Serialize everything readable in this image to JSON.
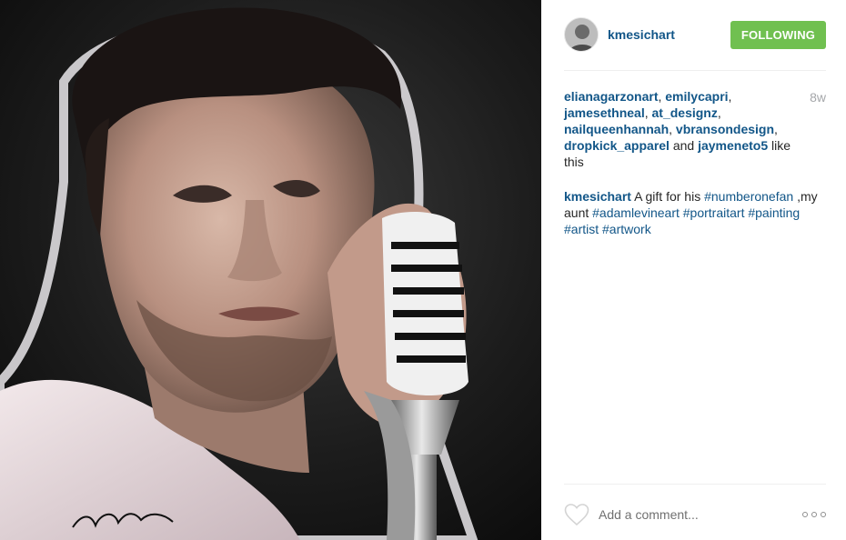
{
  "post": {
    "image_alt": "Painted portrait of a man singing into a vintage microphone",
    "artwork_signature": "Kayla Mesich"
  },
  "header": {
    "username": "kmesichart",
    "follow_label": "FOLLOWING"
  },
  "likes": {
    "users": [
      "elianagarzonart",
      "emilycapri",
      "jamesethneal",
      "at_designz",
      "nailqueenhannah",
      "vbransondesign",
      "dropkick_apparel"
    ],
    "connector": "and",
    "last_user": "jaymeneto5",
    "suffix": "like this",
    "age": "8w"
  },
  "caption": {
    "author": "kmesichart",
    "text_part1": "A gift for his",
    "tag1": "#numberonefan",
    "text_part2": ",my aunt",
    "tags": [
      "#adamlevineart",
      "#portraitart",
      "#painting",
      "#artist",
      "#artwork"
    ]
  },
  "footer": {
    "comment_placeholder": "Add a comment...",
    "heart_icon": "heart-outline-icon",
    "more_icon": "more-options-icon"
  },
  "colors": {
    "link": "#125688",
    "follow_button": "#70c050",
    "muted": "#a5a7aa"
  }
}
